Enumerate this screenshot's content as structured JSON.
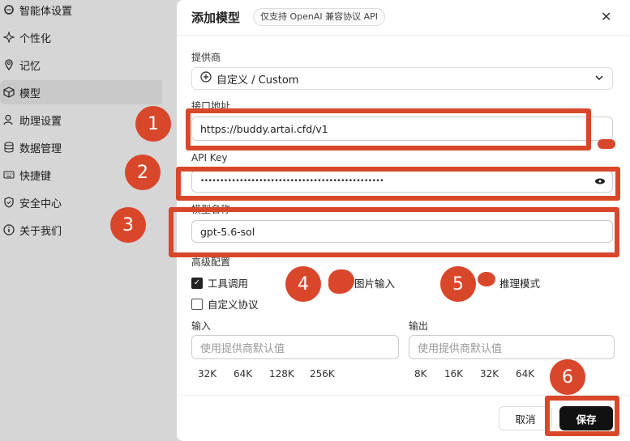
{
  "sidebar": {
    "items": [
      {
        "label": "智能体设置",
        "icon": "agent-icon"
      },
      {
        "label": "个性化",
        "icon": "sparkle-icon"
      },
      {
        "label": "记忆",
        "icon": "pin-icon"
      },
      {
        "label": "模型",
        "icon": "cube-icon"
      },
      {
        "label": "助理设置",
        "icon": "user-icon"
      },
      {
        "label": "数据管理",
        "icon": "database-icon"
      },
      {
        "label": "快捷键",
        "icon": "keyboard-icon"
      },
      {
        "label": "安全中心",
        "icon": "shield-icon"
      },
      {
        "label": "关于我们",
        "icon": "info-icon"
      }
    ]
  },
  "modal": {
    "title": "添加模型",
    "badge": "仅支持 OpenAI 兼容协议 API",
    "provider": {
      "label": "提供商",
      "value": "自定义 / Custom"
    },
    "endpoint": {
      "label": "接口地址",
      "value": "https://buddy.artai.cfd/v1"
    },
    "api_key": {
      "label": "API Key",
      "value": "•••••••••••••••••••••••••••••••••••••••••••••••"
    },
    "model_name": {
      "label": "模型名称",
      "value": "gpt-5.6-sol"
    },
    "advanced": {
      "label": "高级配置",
      "tool_call": "工具调用",
      "image_input": "图片输入",
      "reasoning": "推理模式",
      "custom_protocol": "自定义协议"
    },
    "input_ctx": {
      "label": "输入",
      "placeholder": "使用提供商默认值",
      "chips": [
        "32K",
        "64K",
        "128K",
        "256K"
      ]
    },
    "output_ctx": {
      "label": "输出",
      "placeholder": "使用提供商默认值",
      "chips": [
        "8K",
        "16K",
        "32K",
        "64K"
      ]
    },
    "cancel": "取消",
    "save": "保存"
  },
  "annotations": [
    "1",
    "2",
    "3",
    "4",
    "5",
    "6"
  ],
  "colors": {
    "annotation": "#d9472b",
    "primary": "#111111"
  }
}
